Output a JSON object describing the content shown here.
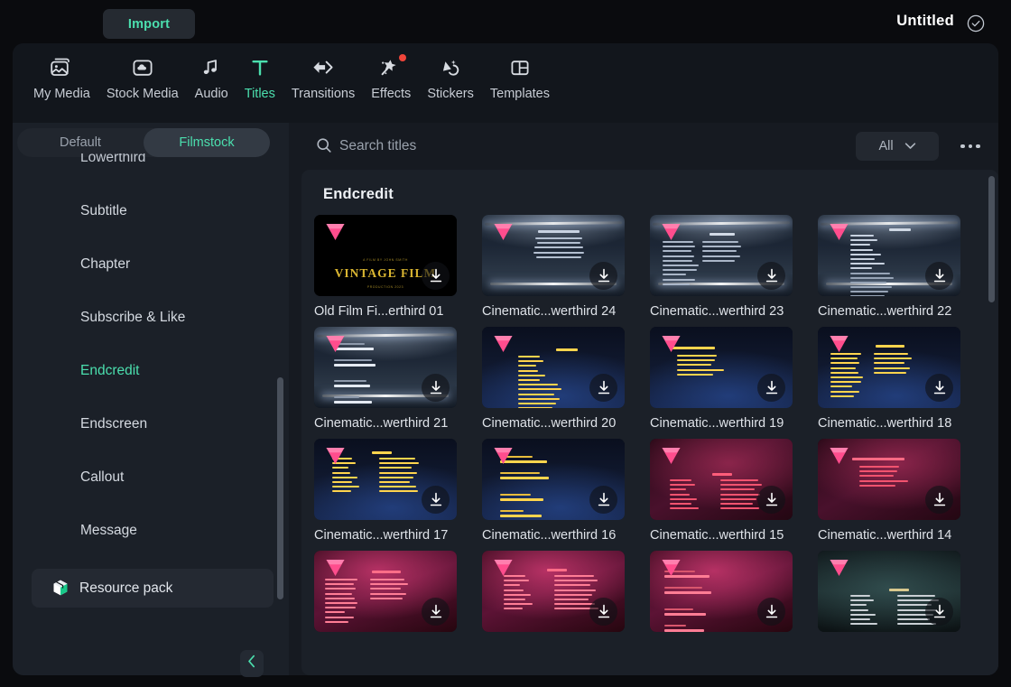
{
  "titlebar": {
    "import_label": "Import",
    "project_title": "Untitled",
    "check_icon": "check-circle-icon"
  },
  "tabs": [
    {
      "label": "My Media",
      "icon": "media-image-icon",
      "active": false,
      "badge": false
    },
    {
      "label": "Stock Media",
      "icon": "cloud-folder-icon",
      "active": false,
      "badge": false
    },
    {
      "label": "Audio",
      "icon": "music-note-icon",
      "active": false,
      "badge": false
    },
    {
      "label": "Titles",
      "icon": "text-t-icon",
      "active": true,
      "badge": false
    },
    {
      "label": "Transitions",
      "icon": "transition-arrows-icon",
      "active": false,
      "badge": false
    },
    {
      "label": "Effects",
      "icon": "magic-wand-star-icon",
      "active": false,
      "badge": true
    },
    {
      "label": "Stickers",
      "icon": "sticker-sparkle-icon",
      "active": false,
      "badge": false
    },
    {
      "label": "Templates",
      "icon": "layout-template-icon",
      "active": false,
      "badge": false
    }
  ],
  "sidebar": {
    "segments": [
      {
        "label": "Default",
        "selected": false
      },
      {
        "label": "Filmstock",
        "selected": true
      }
    ],
    "categories": [
      {
        "label": "Lowerthird",
        "active": false
      },
      {
        "label": "Subtitle",
        "active": false
      },
      {
        "label": "Chapter",
        "active": false
      },
      {
        "label": "Subscribe & Like",
        "active": false
      },
      {
        "label": "Endcredit",
        "active": true
      },
      {
        "label": "Endscreen",
        "active": false
      },
      {
        "label": "Callout",
        "active": false
      },
      {
        "label": "Message",
        "active": false
      }
    ],
    "resource_pack": {
      "label": "Resource pack",
      "icon": "package-box-icon"
    },
    "collapse_icon": "chevron-left-icon"
  },
  "search": {
    "placeholder": "Search titles",
    "value": "",
    "icon": "search-icon",
    "filter_value": "All",
    "filter_chevron": "chevron-down-icon",
    "more_icon": "more-horizontal-icon"
  },
  "content": {
    "group_title": "Endcredit",
    "download_icon": "download-icon",
    "premium_icon": "pink-diamond-icon",
    "items": [
      {
        "caption": "Old Film Fi...erthird 01",
        "art": "vintage"
      },
      {
        "caption": "Cinematic...werthird 24",
        "art": "stage-thanks"
      },
      {
        "caption": "Cinematic...werthird 23",
        "art": "stage-actors"
      },
      {
        "caption": "Cinematic...werthird 22",
        "art": "stage-cast"
      },
      {
        "caption": "Cinematic...werthird 21",
        "art": "stage-crew"
      },
      {
        "caption": "Cinematic...werthird 20",
        "art": "space-cast-yellow"
      },
      {
        "caption": "Cinematic...werthird 19",
        "art": "space-thanks-yellow"
      },
      {
        "caption": "Cinematic...werthird 18",
        "art": "space-actors-yellow"
      },
      {
        "caption": "Cinematic...werthird 17",
        "art": "space-cast2-yellow"
      },
      {
        "caption": "Cinematic...werthird 16",
        "art": "space-crew-yellow"
      },
      {
        "caption": "Cinematic...werthird 15",
        "art": "maroon-cast"
      },
      {
        "caption": "Cinematic...werthird 14",
        "art": "maroon-thanks"
      },
      {
        "caption": "",
        "art": "pink-actors"
      },
      {
        "caption": "",
        "art": "pink-cast"
      },
      {
        "caption": "",
        "art": "pink-crew"
      },
      {
        "caption": "",
        "art": "teal-cast"
      }
    ]
  },
  "colors": {
    "accent": "#4bdfae",
    "panel": "#161a21",
    "sidebar": "#1b2028",
    "badge": "#f0453a",
    "gem": "#ff4d8d"
  }
}
